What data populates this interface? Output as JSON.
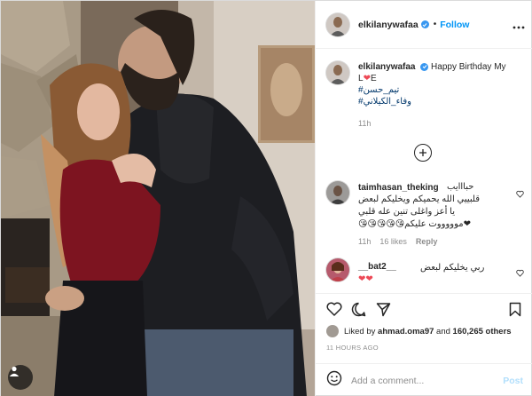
{
  "header": {
    "username": "elkilanywafaa",
    "separator": "•",
    "follow_label": "Follow"
  },
  "caption": {
    "username": "elkilanywafaa",
    "text_before": "Happy Birthday My",
    "line2_pre": "L",
    "heart_glyph": "❤",
    "line2_post": "E",
    "tag1": "#تيم_حسن",
    "tag2": "#وفاء_الكيلاني",
    "time": "11h"
  },
  "comments": [
    {
      "username": "taimhasan_theking",
      "lines": [
        "حبااايب",
        "قلبييي الله يحميكم ويخليكم لبعض",
        "يا أعز واغلى تنين عله قلبي",
        "❤موووووت عليكم😘😘😘😘😘"
      ],
      "time": "11h",
      "likes": "16 likes",
      "reply": "Reply"
    },
    {
      "username": "__bat2__",
      "text": "ربي يخليكم لبعض",
      "emoji_line": "❤❤"
    }
  ],
  "actions": {
    "liked_by_prefix": "Liked by",
    "liked_by_user": "ahmad.oma97",
    "liked_by_and": "and",
    "liked_count": "160,265 others",
    "ago": "11 HOURS AGO"
  },
  "add_comment": {
    "placeholder": "Add a comment...",
    "post_label": "Post"
  },
  "colors": {
    "link_blue": "#0095f6",
    "verified_blue": "#3897f0",
    "heart_red": "#ed4956",
    "muted_gray": "#8e8e8e",
    "post_disabled": "#b2dffc"
  },
  "icons": [
    "verified-badge-icon",
    "plus-circle-icon",
    "heart-outline-icon",
    "comment-icon",
    "share-icon",
    "bookmark-icon",
    "emoji-icon",
    "more-icon"
  ]
}
